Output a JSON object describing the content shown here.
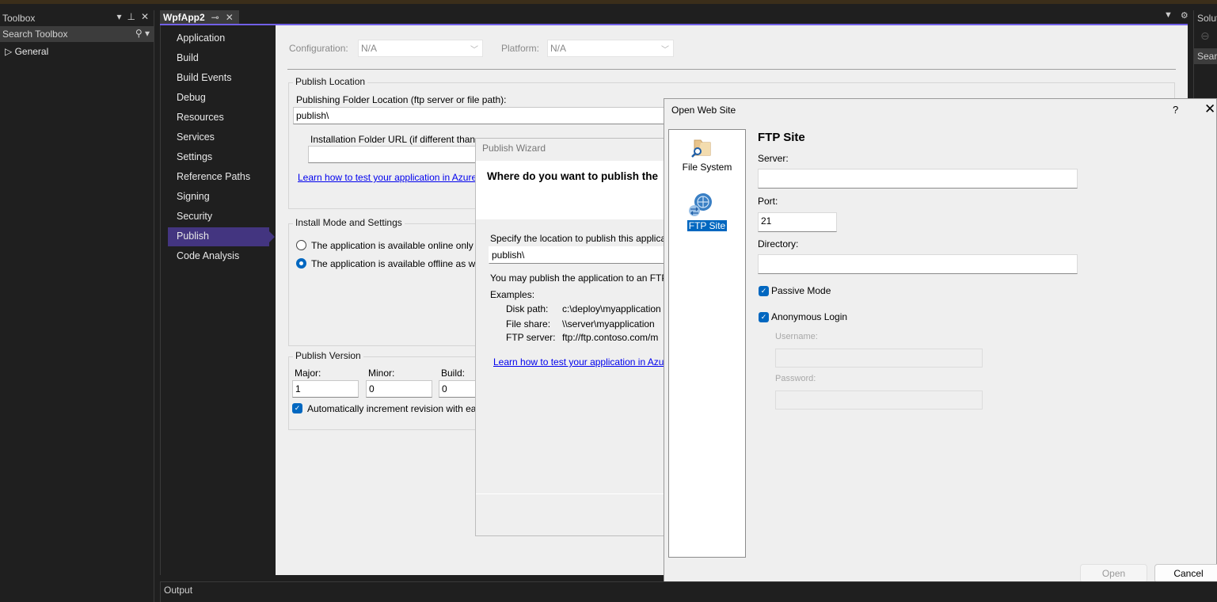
{
  "toolbox": {
    "title": "Toolbox",
    "controls": [
      "▾",
      "⊥",
      "✕"
    ],
    "search_placeholder": "Search Toolbox",
    "group": "General"
  },
  "document_tab": {
    "label": "WpfApp2",
    "pin": "⊸",
    "close": "✕"
  },
  "solution_explorer": {
    "title": "Solut",
    "search_placeholder": "Searc"
  },
  "property_nav": {
    "items": [
      {
        "label": "Application"
      },
      {
        "label": "Build"
      },
      {
        "label": "Build Events"
      },
      {
        "label": "Debug"
      },
      {
        "label": "Resources"
      },
      {
        "label": "Services"
      },
      {
        "label": "Settings"
      },
      {
        "label": "Reference Paths"
      },
      {
        "label": "Signing"
      },
      {
        "label": "Security"
      },
      {
        "label": "Publish",
        "selected": true
      },
      {
        "label": "Code Analysis"
      }
    ]
  },
  "publish_page": {
    "configuration_label": "Configuration:",
    "configuration_value": "N/A",
    "platform_label": "Platform:",
    "platform_value": "N/A",
    "publish_location": {
      "title": "Publish Location",
      "folder_label": "Publishing Folder Location (ftp server or file path):",
      "folder_value": "publish\\",
      "install_url_label": "Installation Folder URL (if different than",
      "install_url_value": "",
      "learn_link": "Learn how to test your application in Azure"
    },
    "install_mode": {
      "title": "Install Mode and Settings",
      "options": [
        {
          "label": "The application is available online only",
          "selected": false
        },
        {
          "label": "The application is available offline as we",
          "selected": true
        }
      ]
    },
    "publish_version": {
      "title": "Publish Version",
      "major_label": "Major:",
      "major_value": "1",
      "minor_label": "Minor:",
      "minor_value": "0",
      "build_label": "Build:",
      "build_value": "0",
      "auto_increment_label": "Automatically increment revision with ea",
      "auto_increment_checked": true
    }
  },
  "publish_wizard": {
    "title": "Publish Wizard",
    "heading": "Where do you want to publish the",
    "specify_label": "Specify the location to publish this applica",
    "location_value": "publish\\",
    "ftp_note": "You may publish the application to an FTP",
    "examples_label": "Examples:",
    "examples": [
      {
        "kind": "Disk path:",
        "value": "c:\\deploy\\myapplication"
      },
      {
        "kind": "File share:",
        "value": "\\\\server\\myapplication"
      },
      {
        "kind": "FTP server:",
        "value": "ftp://ftp.contoso.com/m"
      }
    ],
    "learn_link": "Learn how to test your application in Azu"
  },
  "open_web_site": {
    "title": "Open Web Site",
    "help": "?",
    "close": "✕",
    "locations": [
      {
        "label": "File System",
        "icon": "folder-search-icon",
        "selected": false
      },
      {
        "label": "FTP Site",
        "icon": "ftp-globe-icon",
        "selected": true
      }
    ],
    "heading": "FTP Site",
    "server_label": "Server:",
    "server_value": "",
    "port_label": "Port:",
    "port_value": "21",
    "directory_label": "Directory:",
    "directory_value": "",
    "passive_mode_label": "Passive Mode",
    "passive_mode_checked": true,
    "anonymous_login_label": "Anonymous Login",
    "anonymous_login_checked": true,
    "username_label": "Username:",
    "username_value": "",
    "password_label": "Password:",
    "password_value": "",
    "open_button": "Open",
    "cancel_button": "Cancel"
  },
  "output_panel": {
    "title": "Output"
  },
  "colors": {
    "accent": "#7160e8",
    "nav_selected": "#433580",
    "checkbox_blue": "#0067c0",
    "link": "#0000ee"
  }
}
